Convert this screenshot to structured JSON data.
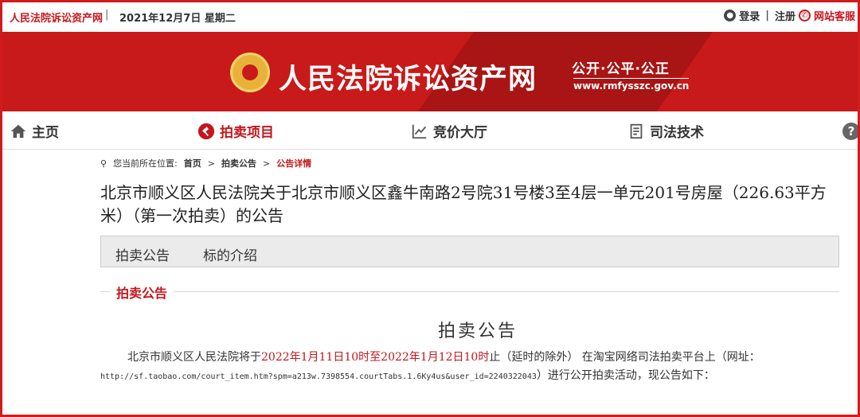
{
  "topbar": {
    "site_name": "人民法院诉讼资产网",
    "separator": "|",
    "date": "2021年12月7日 星期二",
    "login": "登录",
    "divider": "|",
    "register": "注册",
    "service": "网站客服"
  },
  "banner": {
    "title": "人民法院诉讼资产网",
    "slogan": "公开·公平·公正",
    "url": "www.rmfysszc.gov.cn"
  },
  "nav": {
    "home": "主页",
    "auction": "拍卖项目",
    "hall": "竞价大厅",
    "tech": "司法技术",
    "help": "?"
  },
  "breadcrumb": {
    "prefix": "您当前所在位置:",
    "home": "首页",
    "arrow1": ">",
    "notice": "拍卖公告",
    "arrow2": ">",
    "current": "公告详情"
  },
  "page_title": "北京市顺义区人民法院关于北京市顺义区鑫牛南路2号院31号楼3至4层一单元201号房屋（226.63平方米）（第一次拍卖）的公告",
  "tabs": [
    "拍卖公告",
    "标的介绍"
  ],
  "section_label": "拍卖公告",
  "notice_title": "拍卖公告",
  "body": {
    "part1": "北京市顺义区人民法院将于",
    "time_range": "2022年1月11日10时至2022年1月12日10时",
    "part2": "止（延时的除外） 在淘宝网络司法拍卖平台上（网址：",
    "url": "http://sf.taobao.com/court_item.htm?spm=a213w.7398554.courtTabs.1.6Ky4us&user_id=2240322043",
    "part3": "）进行公开拍卖活动，现公告如下："
  },
  "colors": {
    "brand_red": "#c4161c",
    "banner_red": "#c81a1a"
  }
}
